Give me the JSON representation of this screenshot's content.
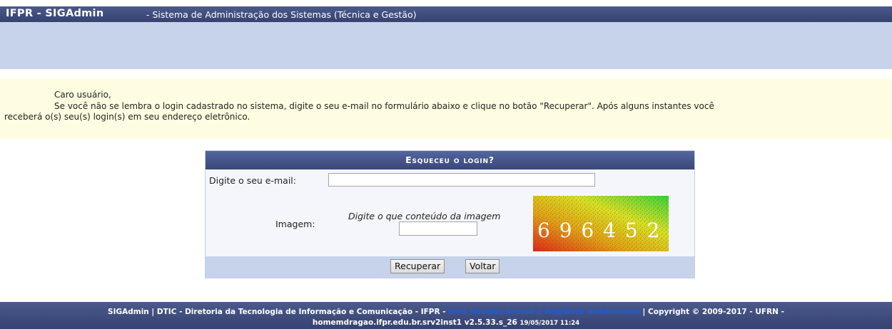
{
  "header": {
    "app_name": "IFPR - SIGAdmin",
    "system_name": "- Sistema de Administração dos Sistemas (Técnica e Gestão)"
  },
  "notice": {
    "greeting": "Caro usuário,",
    "line1": "Se você não se lembra o login cadastrado no sistema, digite o seu e-mail no formulário abaixo e clique no botão \"Recuperar\". Após alguns instantes você",
    "line2": "receberá o(s) seu(s) login(s) em seu endereço eletrônico."
  },
  "form": {
    "title": "Esqueceu o login?",
    "email_label": "Digite o seu e-mail:",
    "email_value": "",
    "image_label": "Imagem:",
    "image_hint": "Digite o que conteúdo da imagem",
    "captcha_value": "",
    "captcha_text": "6 9 6 4 5 2",
    "recover_button": "Recuperar",
    "back_button": "Voltar"
  },
  "footer": {
    "line1_part1": "SIGAdmin | DTIC - Diretoria da Tecnologia de Informação e Comunicação - IFPR -",
    "helpdesk_link": "Para dúvidas acesse o HelpDesk Institucional",
    "line1_part2": "| Copyright © 2009-2017 - UFRN -",
    "host": "homemdragao.ifpr.edu.br.srv2inst1 v2.5.33.s_26",
    "timestamp": "19/05/2017 11:24"
  },
  "colors": {
    "header_bg": "#3d4a7b",
    "band_bg": "#c6d3eb",
    "notice_bg": "#fefde1",
    "link": "#1f5ad6"
  }
}
